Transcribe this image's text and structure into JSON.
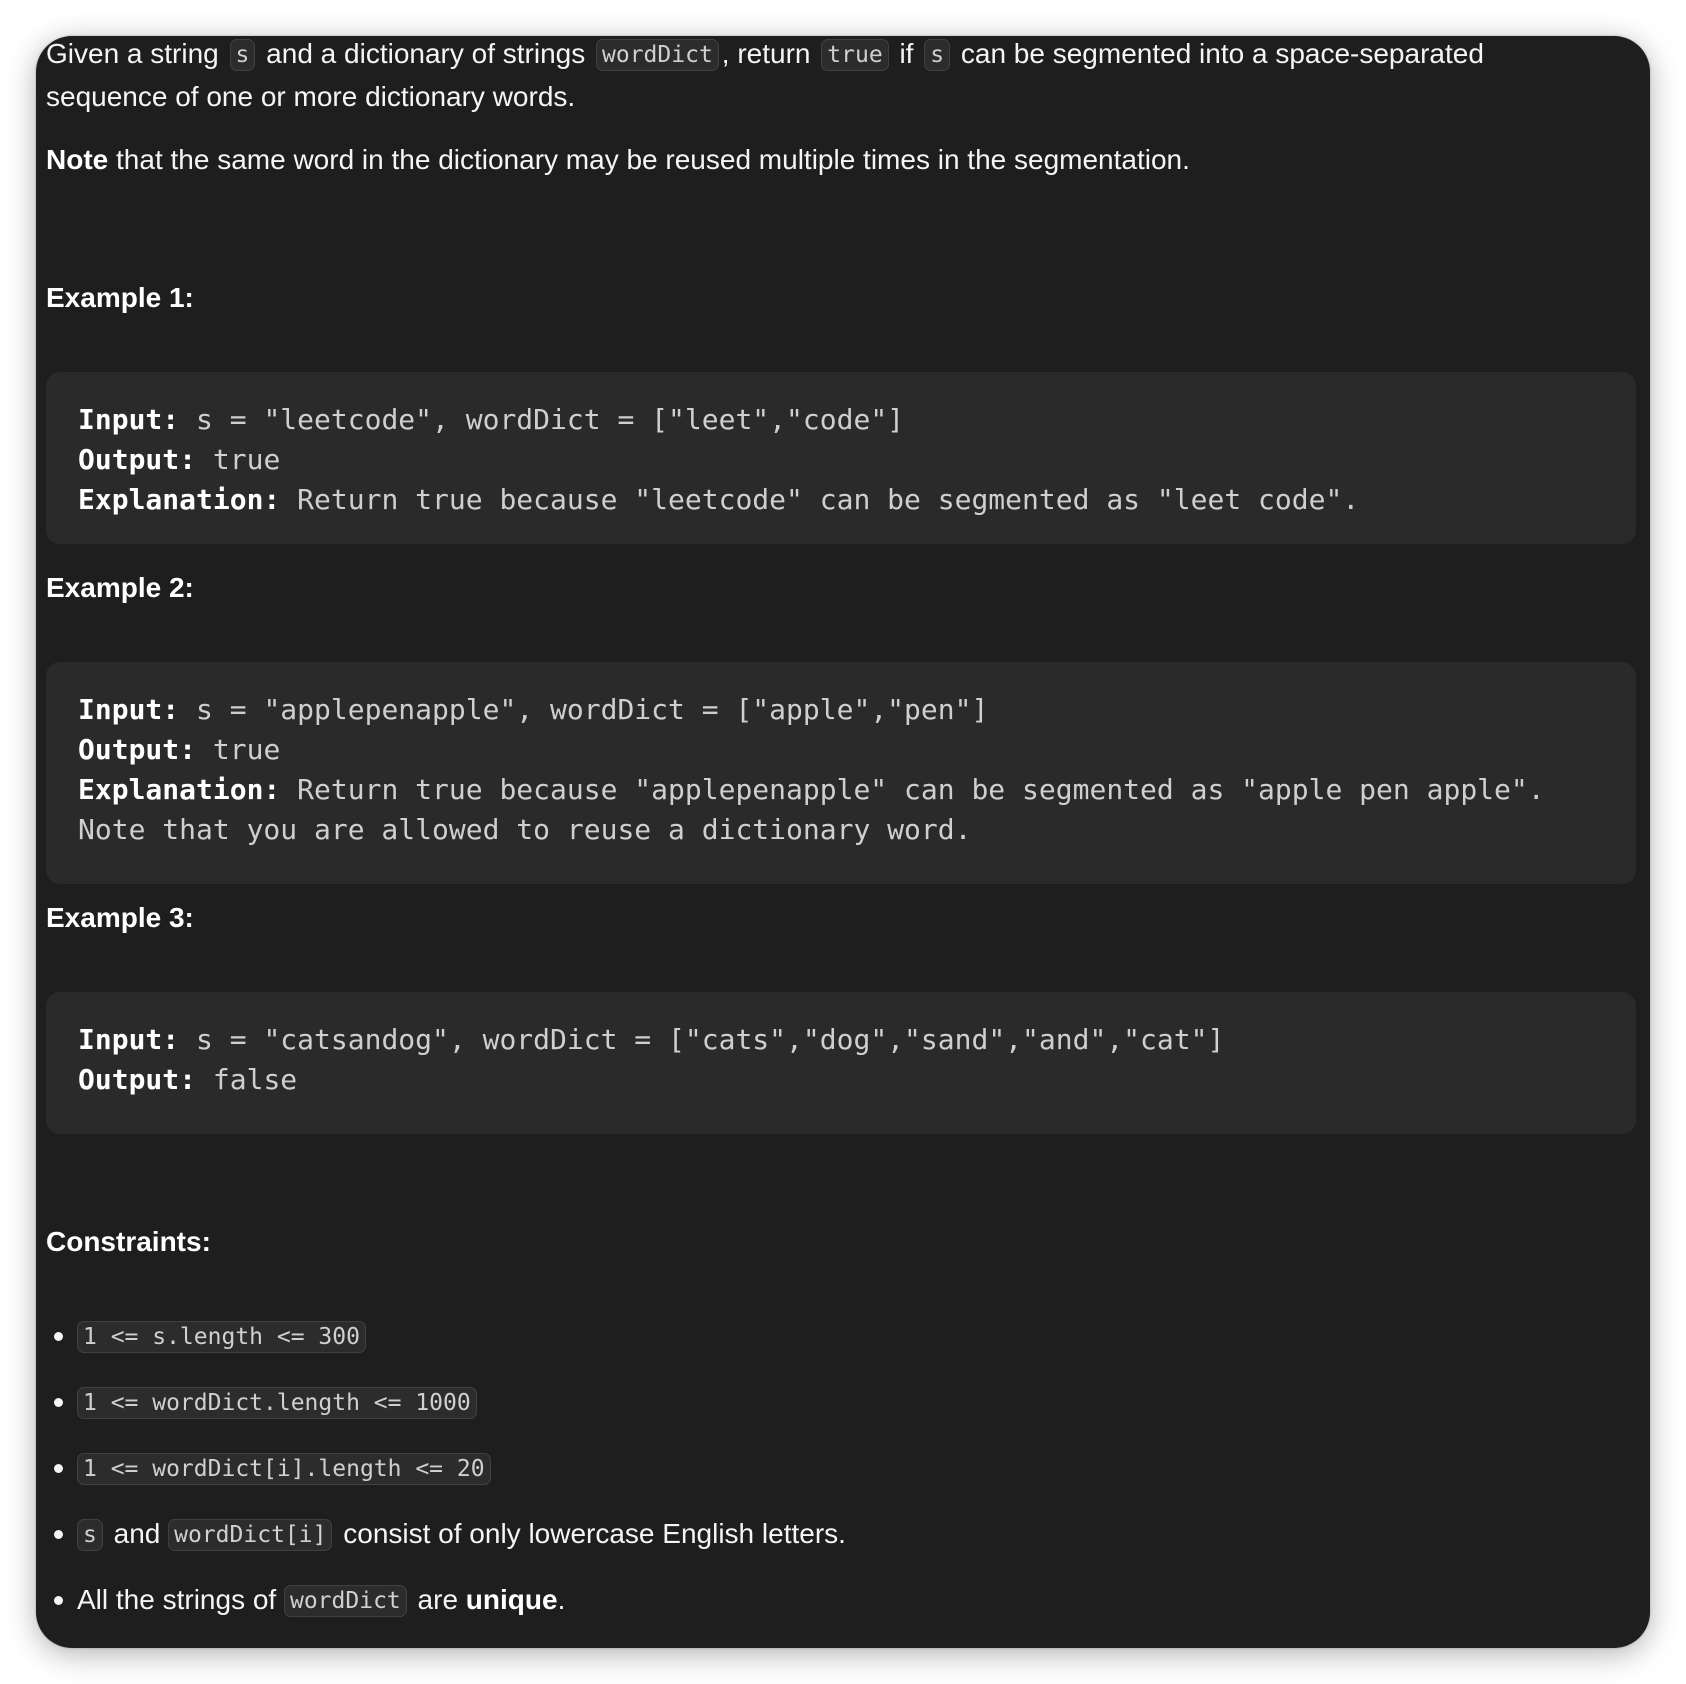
{
  "intro": {
    "t1": "Given a string",
    "c1": "s",
    "t2": "and a dictionary of strings",
    "c2": "wordDict",
    "t3": ", return",
    "c3": "true",
    "t4": "if",
    "c4": "s",
    "t5": "can be segmented into a space-separated",
    "t6": "sequence of one or more dictionary words."
  },
  "note": {
    "bold": "Note",
    "text": "that the same word in the dictionary may be reused multiple times in the segmentation."
  },
  "examples": [
    {
      "heading": "Example 1:",
      "input_label": "Input:",
      "input": "s = \"leetcode\", wordDict = [\"leet\",\"code\"]",
      "output_label": "Output:",
      "output": "true",
      "explanation_label": "Explanation:",
      "explanation": "Return true because \"leetcode\" can be segmented as \"leet code\"."
    },
    {
      "heading": "Example 2:",
      "input_label": "Input:",
      "input": "s = \"applepenapple\", wordDict = [\"apple\",\"pen\"]",
      "output_label": "Output:",
      "output": "true",
      "explanation_label": "Explanation:",
      "explanation": "Return true because \"applepenapple\" can be segmented as \"apple pen apple\".",
      "explanation_cont": "Note that you are allowed to reuse a dictionary word."
    },
    {
      "heading": "Example 3:",
      "input_label": "Input:",
      "input": "s = \"catsandog\", wordDict = [\"cats\",\"dog\",\"sand\",\"and\",\"cat\"]",
      "output_label": "Output:",
      "output": "false"
    }
  ],
  "constraints": {
    "heading": "Constraints:",
    "items": [
      {
        "code": "1 <= s.length <= 300"
      },
      {
        "code": "1 <= wordDict.length <= 1000"
      },
      {
        "code": "1 <= wordDict[i].length <= 20"
      },
      {
        "code": "s",
        "t1": "and",
        "code2": "wordDict[i]",
        "t2": "consist of only lowercase English letters."
      },
      {
        "t0": "All the strings of",
        "code": "wordDict",
        "t1": "are",
        "bold": "unique",
        "t2": "."
      }
    ]
  }
}
